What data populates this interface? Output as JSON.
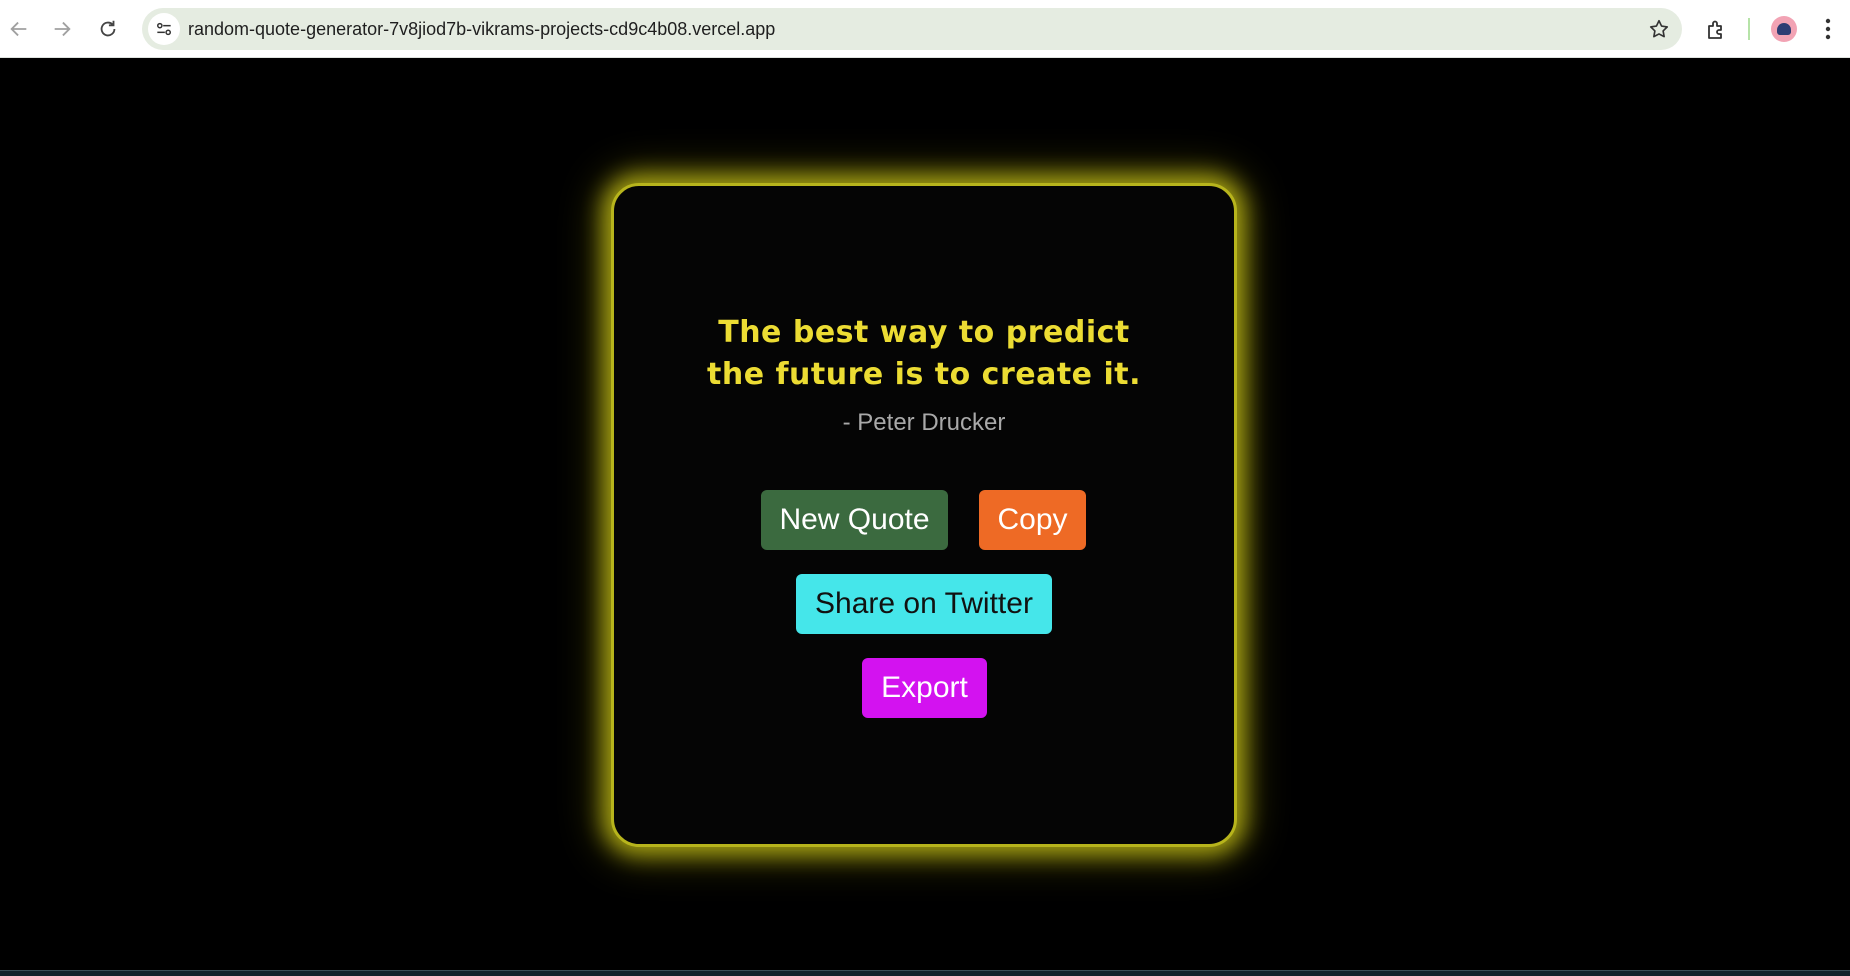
{
  "browser": {
    "url": "random-quote-generator-7v8jiod7b-vikrams-projects-cd9c4b08.vercel.app",
    "icons": [
      "back-icon",
      "forward-icon",
      "reload-icon",
      "site-info-icon",
      "star-icon",
      "extensions-icon",
      "profile-avatar",
      "more-menu-icon"
    ]
  },
  "quote": {
    "line1": "The best way to predict",
    "line2": "the future is to create it.",
    "author": "- Peter Drucker"
  },
  "buttons": {
    "new_quote": "New Quote",
    "copy": "Copy",
    "share_twitter": "Share on Twitter",
    "export": "Export"
  },
  "colors": {
    "page_background": "#000000",
    "card_glow": "#cdc819",
    "quote_text": "#ecdc33",
    "author_text": "#a9a9a9",
    "new_quote_bg": "#3b6a3f",
    "copy_bg": "#ee6a25",
    "twitter_bg": "#45e6ea",
    "export_bg": "#d312f0"
  }
}
